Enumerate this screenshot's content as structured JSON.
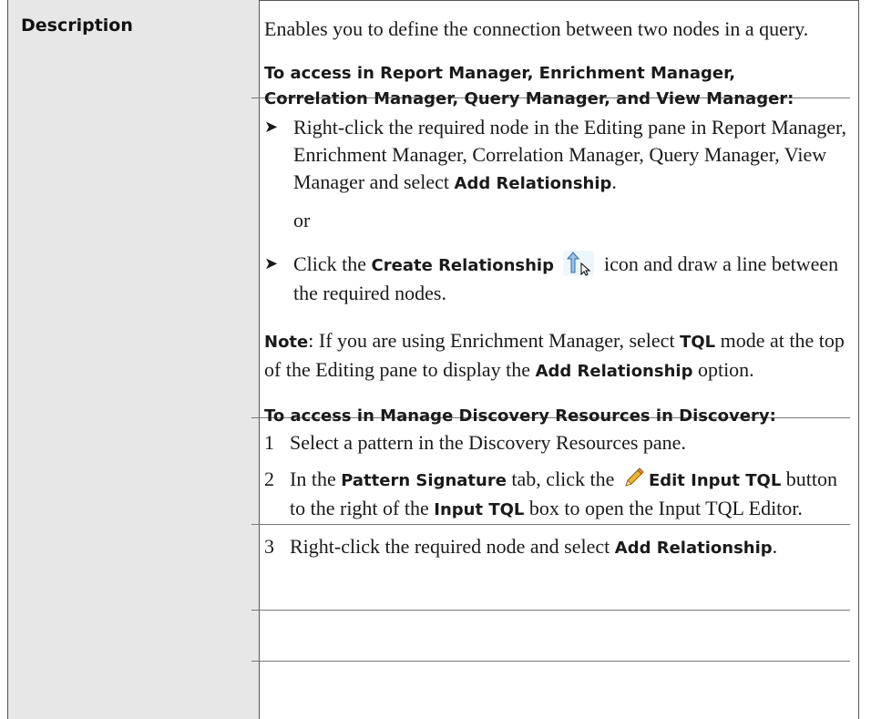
{
  "table": {
    "header_label": "Description",
    "intro": "Enables you to define the connection between two nodes in a query.",
    "access1_heading": "To access in Report Manager, Enrichment Manager, Correlation Manager, Query Manager, and View Manager:",
    "bullet1_text": "Right-click the required node in the Editing pane in Report Manager, Enrichment Manager, Correlation Manager, Query Manager, View Manager and select ",
    "bullet1_bold": "Add Relationship",
    "bullet1_end": ".",
    "or_text": "or",
    "bullet2_pre": "Click the ",
    "bullet2_bold": "Create Relationship",
    "bullet2_post": " icon and draw a line between the required nodes.",
    "note_label": "Note",
    "note_text1": ": If you are using Enrichment Manager, select ",
    "note_tql": "TQL",
    "note_text2": " mode at the top of the Editing pane to display the ",
    "note_add": "Add Relationship",
    "note_text3": " option.",
    "access2_heading": "To access in Manage Discovery Resources in Discovery:",
    "step1_num": "1",
    "step1_text": "Select a pattern in the Discovery Resources pane.",
    "step2_num": "2",
    "step2_pre": "In the ",
    "step2_b1": "Pattern Signature",
    "step2_mid": " tab, click the ",
    "step2_b2": "Edit Input TQL",
    "step2_mid2": " button to the right of the ",
    "step2_b3": "Input TQL",
    "step2_post": " box to open the Input TQL Editor.",
    "step3_num": "3",
    "step3_pre": "Right-click the required node and select ",
    "step3_b": "Add Relationship",
    "step3_end": "."
  },
  "icons": {
    "create_relationship": "create-relationship-icon",
    "edit_pencil": "pencil-icon",
    "bullet_arrow": "arrow-bullet-icon"
  },
  "colors": {
    "header_bg": "#e7e7e7",
    "border": "#555555",
    "text": "#1a1a1a"
  }
}
